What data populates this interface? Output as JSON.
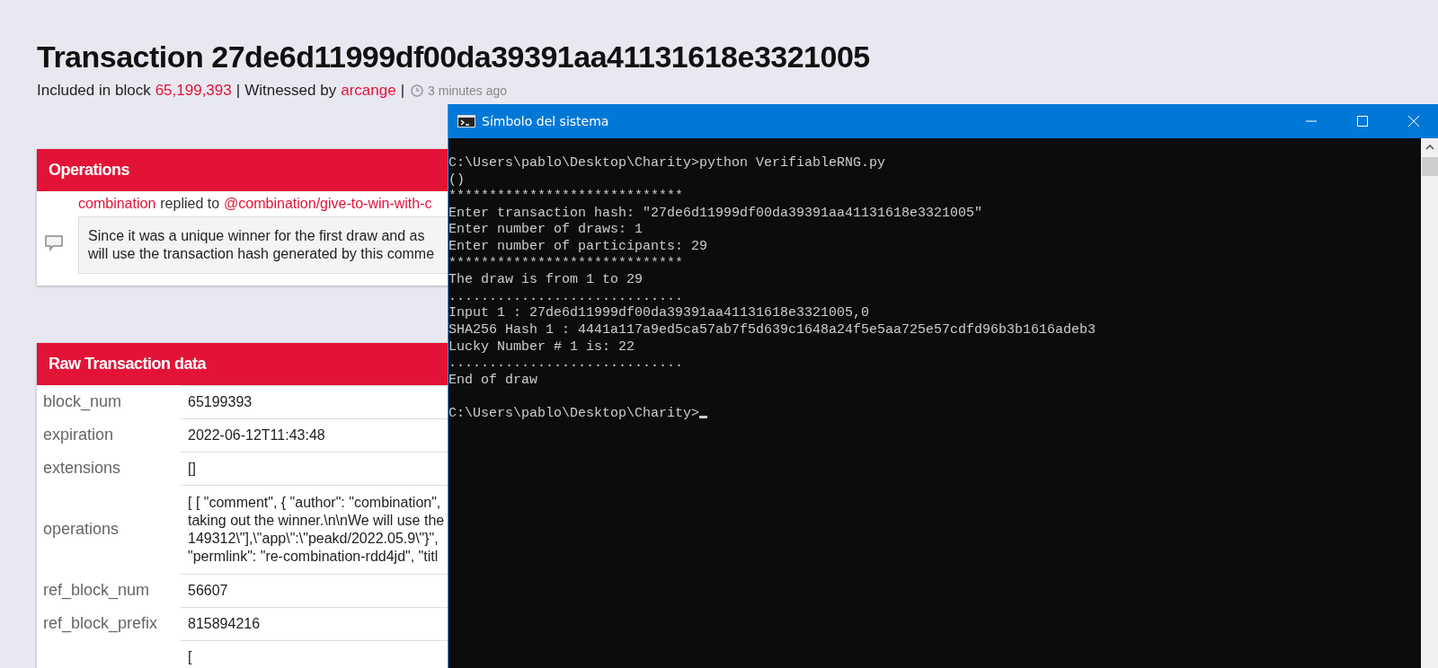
{
  "page": {
    "title": "Transaction 27de6d11999df00da39391aa41131618e3321005",
    "meta": {
      "block_prefix": "Included in block",
      "block": "65,199,393",
      "sep1": "|",
      "witness_prefix": "Witnessed by",
      "witness": "arcange",
      "sep2": "|",
      "time": "3 minutes ago"
    },
    "operations": {
      "heading": "Operations",
      "author": "combination",
      "verb": "replied to",
      "target": "@combination/give-to-win-with-c",
      "body_lines": [
        "Since it was a unique winner for the first draw and as",
        "will use the transaction hash generated by this comme"
      ]
    },
    "raw": {
      "heading": "Raw Transaction data",
      "rows": [
        {
          "label": "block_num",
          "value_lines": [
            "65199393"
          ]
        },
        {
          "label": "expiration",
          "value_lines": [
            "2022-06-12T11:43:48"
          ]
        },
        {
          "label": "extensions",
          "value_lines": [
            "[]"
          ]
        },
        {
          "label": "operations",
          "value_lines": [
            "[ [ \"comment\", { \"author\": \"combination\",",
            "taking out the winner.\\n\\nWe will use the",
            "149312\\\"],\\\"app\\\":\\\"peakd/2022.05.9\\\"}\",",
            "\"permlink\": \"re-combination-rdd4jd\", \"titl"
          ]
        },
        {
          "label": "ref_block_num",
          "value_lines": [
            "56607"
          ]
        },
        {
          "label": "ref_block_prefix",
          "value_lines": [
            "815894216"
          ]
        },
        {
          "value_lines": [
            "["
          ]
        }
      ]
    }
  },
  "terminal": {
    "title": "Símbolo del sistema",
    "lines": [
      {
        "text": "C:\\Users\\pablo\\Desktop\\Charity>python VerifiableRNG.py",
        "gap_before": false
      },
      {
        "text": "()",
        "gap_before": false
      },
      {
        "text": "*****************************",
        "gap_before": false
      },
      {
        "text": "Enter transaction hash: \"27de6d11999df00da39391aa41131618e3321005\"",
        "gap_before": false
      },
      {
        "text": "Enter number of draws: 1",
        "gap_before": false
      },
      {
        "text": "Enter number of participants: 29",
        "gap_before": false
      },
      {
        "text": "*****************************",
        "gap_before": false
      },
      {
        "text": "The draw is from 1 to 29",
        "gap_before": false
      },
      {
        "text": ".............................",
        "gap_before": false
      },
      {
        "text": "Input 1 : 27de6d11999df00da39391aa41131618e3321005,0",
        "gap_before": false
      },
      {
        "text": "SHA256 Hash 1 : 4441a117a9ed5ca57ab7f5d639c1648a24f5e5aa725e57cdfd96b3b1616adeb3",
        "gap_before": false
      },
      {
        "text": "Lucky Number # 1 is: 22",
        "gap_before": false
      },
      {
        "text": ".............................",
        "gap_before": false
      },
      {
        "text": "End of draw",
        "gap_before": false
      },
      {
        "text": "C:\\Users\\pablo\\Desktop\\Charity>",
        "gap_before": true,
        "cursor": true
      }
    ]
  }
}
